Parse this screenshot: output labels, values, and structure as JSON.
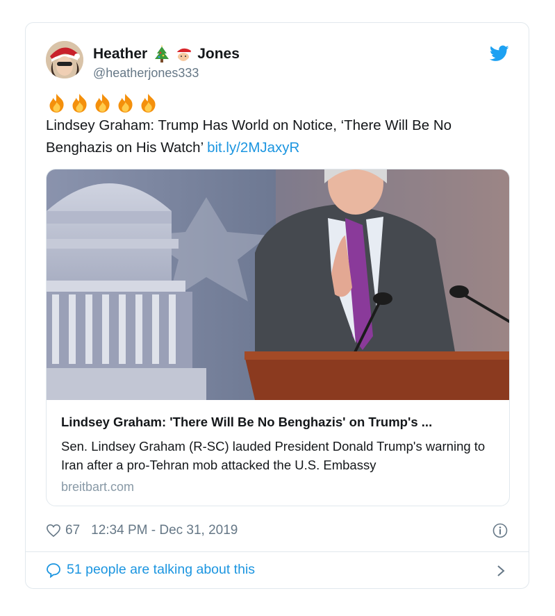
{
  "tweet": {
    "author": {
      "name_first": "Heather",
      "name_last": "Jones",
      "name_emojis": [
        "christmas-tree",
        "santa"
      ],
      "handle": "@heatherjones333"
    },
    "fire_emojis": [
      "fire",
      "fire",
      "fire",
      "fire",
      "fire"
    ],
    "text": "Lindsey Graham: Trump Has World on Notice, ‘There Will Be No Benghazis on His Watch’",
    "link": "bit.ly/2MJaxyR",
    "card": {
      "title": "Lindsey Graham: 'There Will Be No Benghazis' on Trump's ...",
      "description": "Sen. Lindsey Graham (R-SC) lauded President Donald Trump's warning to Iran after a pro-Tehran mob attacked the U.S. Embassy",
      "domain": "breitbart.com"
    },
    "likes": "67",
    "timestamp": "12:34 PM - Dec 31, 2019",
    "talking": "51 people are talking about this"
  },
  "colors": {
    "accent": "#1b95e0",
    "muted": "#657786",
    "border": "#e1e8ed",
    "text": "#14171a"
  },
  "icons": [
    "twitter-bird-icon",
    "heart-icon",
    "info-icon",
    "speech-bubble-icon",
    "chevron-right-icon"
  ]
}
